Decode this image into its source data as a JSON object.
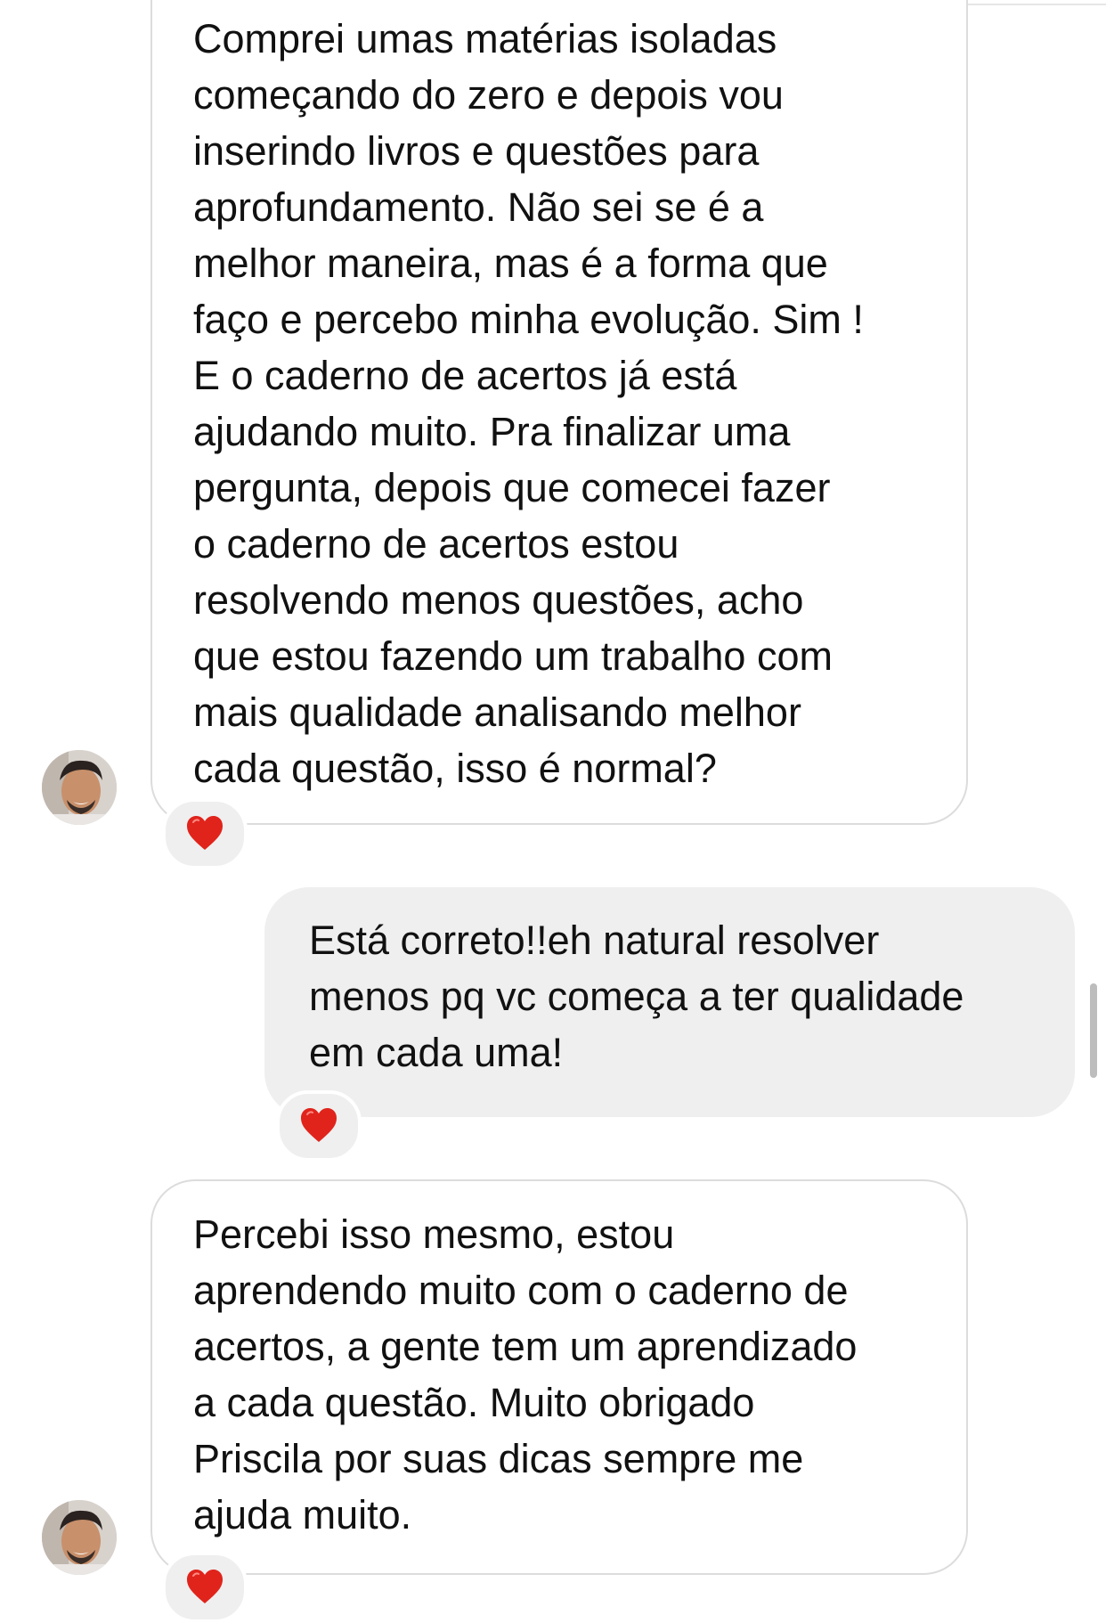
{
  "conversation": {
    "messages": [
      {
        "direction": "incoming",
        "text": "Comprei umas matérias isoladas\ncomeçando do zero e depois vou\ninserindo livros e questões para\naprofundamento. Não sei se é a\nmelhor maneira, mas é a forma que\nfaço e percebo minha evolução. Sim !\nE o caderno de acertos já está\najudando muito. Pra finalizar uma\npergunta, depois que comecei fazer\no caderno de acertos estou\nresolvendo menos questões, acho\nque estou fazendo um trabalho com\nmais qualidade analisando melhor\ncada questão, isso é normal?",
        "reaction": "heart"
      },
      {
        "direction": "outgoing",
        "text": "Está correto!!eh natural resolver\nmenos pq vc começa a ter qualidade\nem cada uma!",
        "reaction": "heart"
      },
      {
        "direction": "incoming",
        "text": "Percebi isso mesmo, estou\naprendendo muito com o caderno de\nacertos, a gente tem um aprendizado\na cada questão. Muito obrigado\nPriscila por suas dicas sempre me\najuda muito.",
        "reaction": "heart"
      }
    ]
  },
  "colors": {
    "incoming_bubble_bg": "#ffffff",
    "incoming_bubble_border": "#dcdcdc",
    "outgoing_bubble_bg": "#efefef",
    "reaction_bg": "#efefef",
    "heart": "#e0241c",
    "text": "#111111"
  },
  "icons": {
    "reaction": "red-heart-icon",
    "avatar": "user-avatar-photo"
  }
}
